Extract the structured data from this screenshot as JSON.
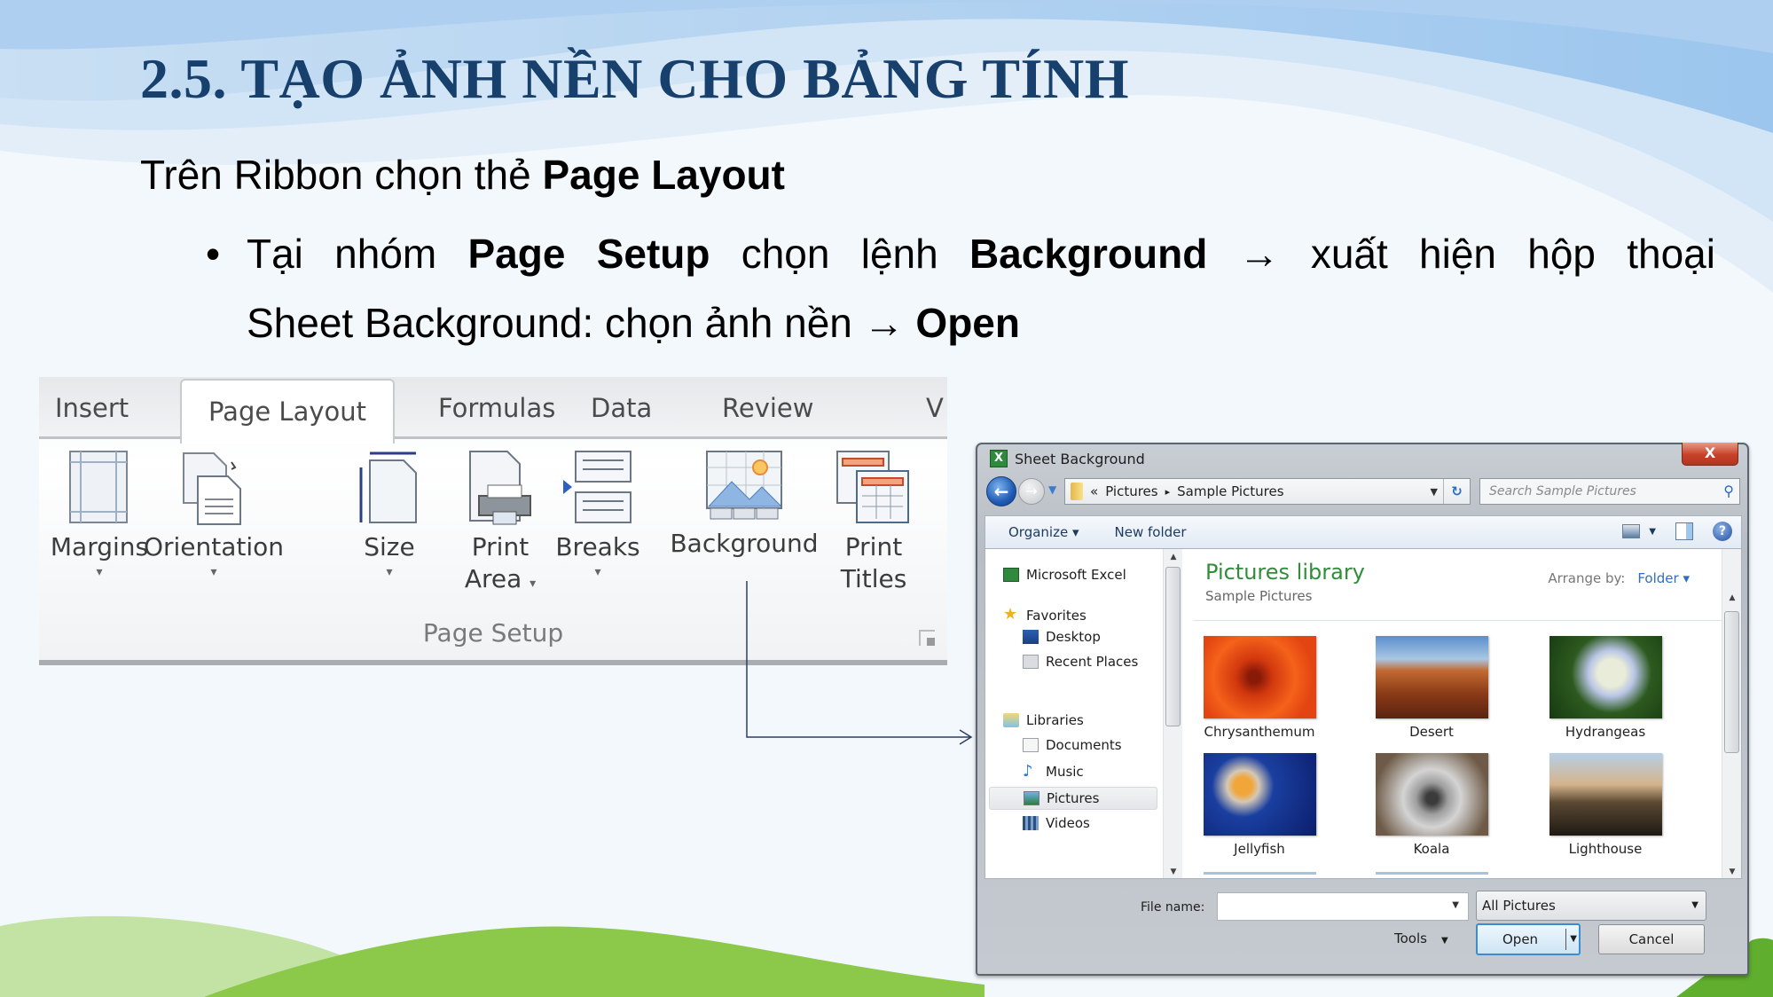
{
  "slide": {
    "title": "2.5. TẠO ẢNH NỀN CHO BẢNG TÍNH",
    "line1_plain": "Trên Ribbon chọn thẻ ",
    "line1_bold": "Page Layout",
    "bullet": {
      "symbol": "•",
      "parts": [
        {
          "text": "Tại",
          "bold": false
        },
        {
          "text": "nhóm",
          "bold": false
        },
        {
          "text": "Page",
          "bold": true
        },
        {
          "text": "Setup",
          "bold": true
        },
        {
          "text": "chọn",
          "bold": false
        },
        {
          "text": "lệnh",
          "bold": false
        },
        {
          "text": "Background",
          "bold": true
        },
        {
          "text": "→",
          "bold": false
        },
        {
          "text": "xuất",
          "bold": false
        },
        {
          "text": "hiện",
          "bold": false
        },
        {
          "text": "hộp",
          "bold": false
        },
        {
          "text": "thoại",
          "bold": false
        }
      ],
      "line2_plain": "Sheet Background: chọn ảnh nền → ",
      "line2_bold": "Open"
    },
    "title_color": "#17406d"
  },
  "ribbon": {
    "tabs": [
      {
        "label": "Insert",
        "active": false
      },
      {
        "label": "Page Layout",
        "active": true
      },
      {
        "label": "Formulas",
        "active": false
      },
      {
        "label": "Data",
        "active": false
      },
      {
        "label": "Review",
        "active": false
      },
      {
        "label": "V",
        "active": false
      }
    ],
    "commands": [
      {
        "line1": "Margins",
        "line2": "",
        "caret": "▾",
        "icon": "margins-icon"
      },
      {
        "line1": "Orientation",
        "line2": "",
        "caret": "▾",
        "icon": "orientation-icon"
      },
      {
        "line1": "Size",
        "line2": "",
        "caret": "▾",
        "icon": "size-icon"
      },
      {
        "line1": "Print",
        "line2": "Area",
        "caret": "▾",
        "icon": "print-area-icon"
      },
      {
        "line1": "Breaks",
        "line2": "",
        "caret": "▾",
        "icon": "breaks-icon"
      },
      {
        "line1": "Background",
        "line2": "",
        "caret": "",
        "icon": "background-icon"
      },
      {
        "line1": "Print",
        "line2": "Titles",
        "caret": "",
        "icon": "print-titles-icon"
      }
    ],
    "group_label": "Page Setup"
  },
  "dialog": {
    "title": "Sheet Background",
    "close_label": "X",
    "breadcrumb": {
      "prefix": "«",
      "items": [
        "Pictures",
        "Sample Pictures"
      ],
      "separator": "▸"
    },
    "search_placeholder": "Search Sample Pictures",
    "toolbar": {
      "organize": "Organize ▾",
      "new_folder": "New folder"
    },
    "nav": [
      {
        "label": "Microsoft Excel",
        "icon": "excel",
        "level": 0
      },
      {
        "label": "Favorites",
        "icon": "star",
        "level": 0
      },
      {
        "label": "Desktop",
        "icon": "desktop",
        "level": 1
      },
      {
        "label": "Recent Places",
        "icon": "recent",
        "level": 1
      },
      {
        "label": "Libraries",
        "icon": "libs",
        "level": 0
      },
      {
        "label": "Documents",
        "icon": "docs",
        "level": 1
      },
      {
        "label": "Music",
        "icon": "music",
        "level": 1
      },
      {
        "label": "Pictures",
        "icon": "pics",
        "level": 1,
        "selected": true
      },
      {
        "label": "Videos",
        "icon": "videos",
        "level": 1
      }
    ],
    "library_title": "Pictures library",
    "library_subtitle": "Sample Pictures",
    "arrange_label": "Arrange by:",
    "arrange_value": "Folder ▾",
    "pictures": [
      {
        "name": "Chrysanthemum",
        "thumb": "chrys"
      },
      {
        "name": "Desert",
        "thumb": "desert"
      },
      {
        "name": "Hydrangeas",
        "thumb": "hydr"
      },
      {
        "name": "Jellyfish",
        "thumb": "jelly"
      },
      {
        "name": "Koala",
        "thumb": "koala"
      },
      {
        "name": "Lighthouse",
        "thumb": "light"
      }
    ],
    "file_name_label": "File name:",
    "file_name_value": "",
    "file_type": "All Pictures",
    "tools_label": "Tools",
    "open_label": "Open",
    "cancel_label": "Cancel"
  }
}
